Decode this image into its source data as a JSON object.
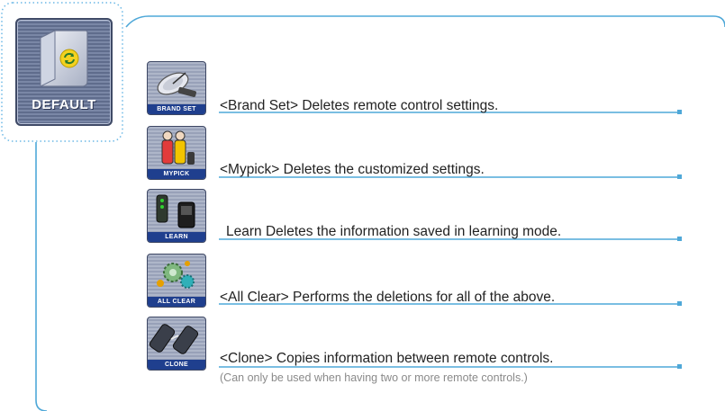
{
  "sidebar": {
    "icon_name": "folder-refresh-icon",
    "label": "DEFAULT"
  },
  "items": [
    {
      "icon_name": "satellite-dish-icon",
      "icon_label": "BRAND SET",
      "caption": "<Brand Set> Deletes remote control settings."
    },
    {
      "icon_name": "people-icon",
      "icon_label": "MYPICK",
      "caption": "<Mypick> Deletes the customized settings."
    },
    {
      "icon_name": "remote-device-icon",
      "icon_label": "LEARN",
      "caption": "Learn   Deletes the information saved in learning mode."
    },
    {
      "icon_name": "gears-icon",
      "icon_label": "ALL CLEAR",
      "caption": "<All Clear> Performs the deletions for all of the above."
    },
    {
      "icon_name": "two-remotes-icon",
      "icon_label": "CLONE",
      "caption": "<Clone> Copies information between remote controls.",
      "note": "(Can only be used when having two or more remote controls.)"
    }
  ],
  "colors": {
    "accent_line": "#4fa8d8",
    "dotted_border": "#6cb8e6",
    "tile_blue": "#1f3f8e"
  }
}
